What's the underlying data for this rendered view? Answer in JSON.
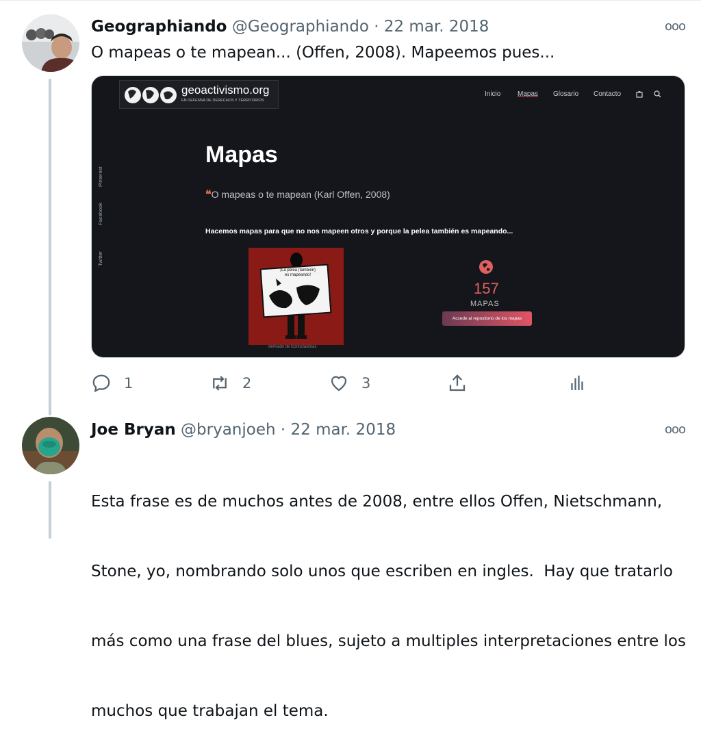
{
  "tweets": [
    {
      "display_name": "Geographiando",
      "handle": "@Geographiando",
      "date": "22 mar. 2018",
      "text": "O mapeas o te mapean... (Offen, 2008). Mapeemos pues...",
      "actions": {
        "reply_count": "1",
        "retweet_count": "2",
        "like_count": "3"
      }
    },
    {
      "display_name": "Joe Bryan",
      "handle": "@bryanjoeh",
      "date": "22 mar. 2018",
      "text_lines": [
        "Esta frase es de muchos antes de 2008, entre ellos Offen, Nietschmann,",
        "Stone, yo, nombrando solo unos que escriben en ingles.  Hay que tratarlo",
        "más como una frase del blues, sujeto a multiples interpretaciones entre los",
        "muchos que trabajan el tema."
      ]
    }
  ],
  "separator": " · ",
  "more_label": "ooo",
  "media": {
    "site_name": "geoactivismo.org",
    "site_tagline": "EN DEFENSA DE DERECHOS Y TERRITORIOS",
    "nav": [
      "Inicio",
      "Mapas",
      "Glosario",
      "Contacto"
    ],
    "social": [
      "Twitter",
      "Facebook",
      "Pinterest"
    ],
    "title": "Mapas",
    "quote_mark": "❝",
    "quote": "O mapeas o te mapean (Karl Offen, 2008)",
    "tagline": "Hacemos mapas para que no nos mapeen otros y porque la pelea también es mapeando...",
    "poster_text": "¡La pelea (también) es mapeando!",
    "poster_caption": "derivado de iconoclasistas",
    "map_count": "157",
    "map_count_label": "MAPAS",
    "repo_button": "Accede al repositorio de los mapas"
  },
  "colors": {
    "accent": "#e06060",
    "meta": "#536471",
    "dark_bg": "#15161c"
  }
}
